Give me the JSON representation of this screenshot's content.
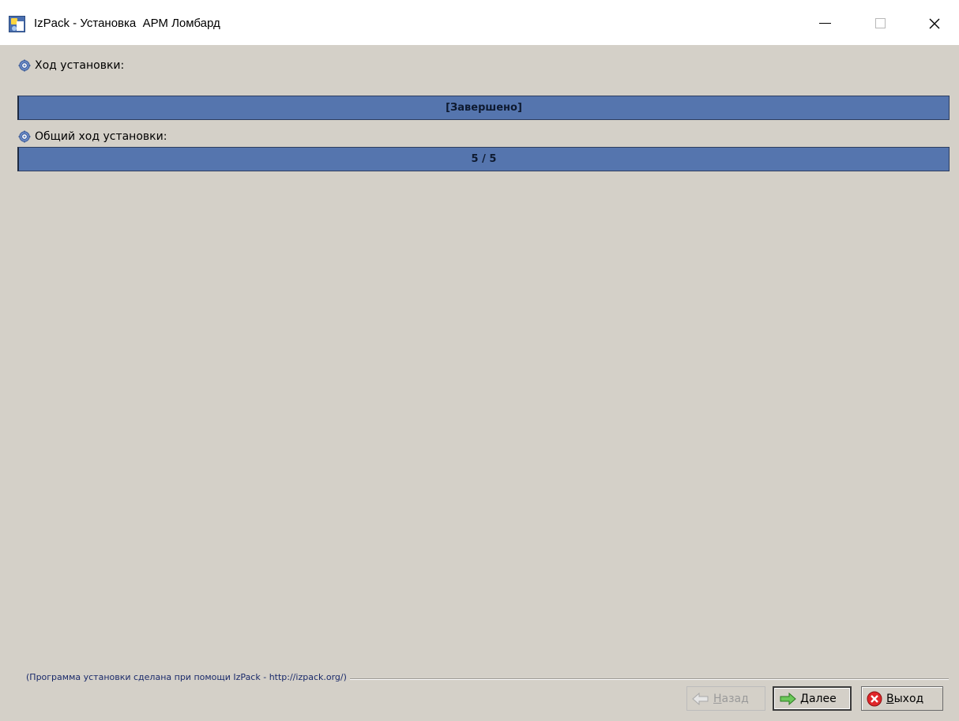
{
  "window": {
    "title": "IzPack - Установка  АРМ Ломбард",
    "app_icon": "izpack-installer-icon",
    "controls": [
      "minimize-icon",
      "maximize-icon",
      "close-icon"
    ]
  },
  "pack_progress": {
    "label": "Ход установки:",
    "icon": "gear-icon",
    "text": "[Завершено]",
    "fraction": 1.0
  },
  "overall_progress": {
    "label": "Общий ход установки:",
    "icon": "gear-icon",
    "text": "5 / 5",
    "fraction": 1.0
  },
  "footer": {
    "credit": "(Программа установки сделана при помощи IzPack - http://izpack.org/)"
  },
  "buttons": {
    "back": {
      "label": "Назад",
      "mnemonic": "Н",
      "rest": "азад",
      "enabled": false,
      "icon": "arrow-left-icon"
    },
    "next": {
      "label": "Далее",
      "mnemonic": "Д",
      "rest": "алее",
      "enabled": true,
      "icon": "arrow-right-icon"
    },
    "quit": {
      "label": "Выход",
      "mnemonic": "В",
      "rest": "ыход",
      "enabled": true,
      "icon": "stop-icon"
    }
  },
  "colors": {
    "background": "#d4d0c8",
    "progress_fill": "#5575ae",
    "footer_text": "#1a2a6a"
  }
}
